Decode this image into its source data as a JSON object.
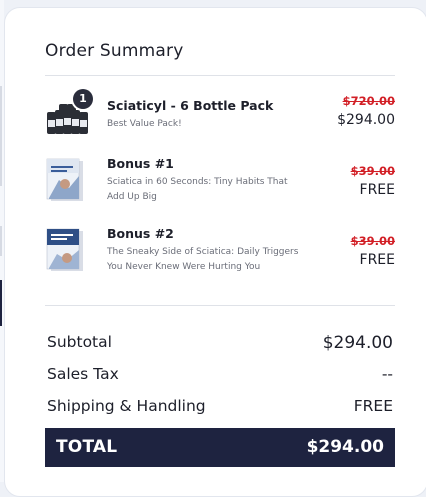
{
  "order_summary": {
    "title": "Order Summary",
    "items": [
      {
        "name": "Sciaticyl - 6 Bottle Pack",
        "desc": "Best Value Pack!",
        "old_price": "$720.00",
        "price": "$294.00",
        "qty": "1",
        "thumb": "bottle-pack-icon"
      },
      {
        "name": "Bonus #1",
        "desc": "Sciatica in 60 Seconds: Tiny Habits That Add Up Big",
        "old_price": "$39.00",
        "price": "FREE",
        "thumb": "ebook-cover-icon"
      },
      {
        "name": "Bonus #2",
        "desc": "The Sneaky Side of Sciatica: Daily Triggers You Never Knew Were Hurting You",
        "old_price": "$39.00",
        "price": "FREE",
        "thumb": "ebook-cover-icon"
      }
    ],
    "summary": {
      "subtotal_label": "Subtotal",
      "subtotal_value": "$294.00",
      "tax_label": "Sales Tax",
      "tax_value": "--",
      "shipping_label": "Shipping & Handling",
      "shipping_value": "FREE"
    },
    "total": {
      "label": "TOTAL",
      "value": "$294.00"
    },
    "colors": {
      "accent_dark": "#1e2340",
      "strike_red": "#d21f26"
    }
  }
}
